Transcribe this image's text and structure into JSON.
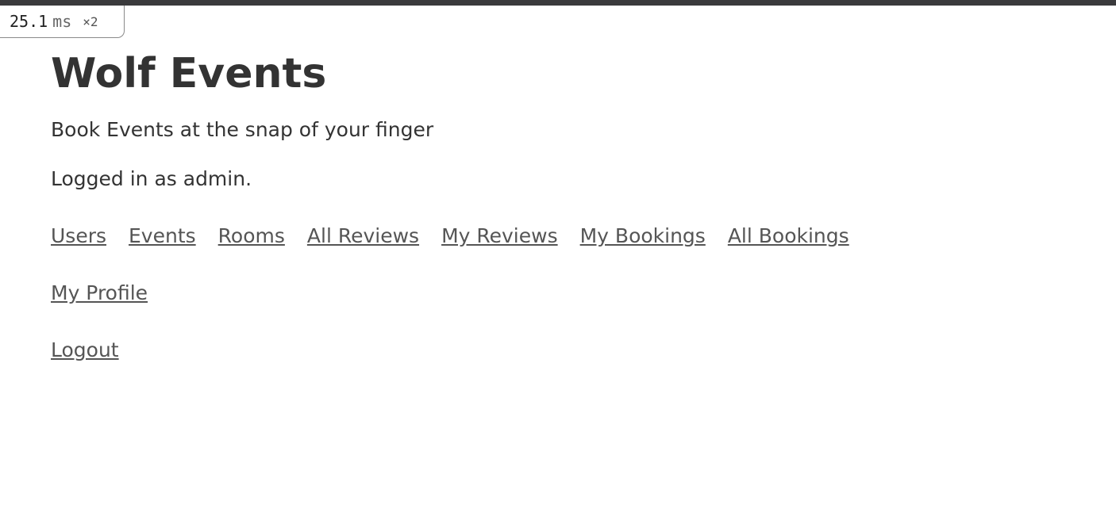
{
  "perf": {
    "value": "25.1",
    "unit": "ms",
    "multiplier": "×2"
  },
  "header": {
    "title": "Wolf Events",
    "tagline": "Book Events at the snap of your finger"
  },
  "status": {
    "login_text": "Logged in as admin."
  },
  "nav": {
    "items": [
      {
        "label": "Users"
      },
      {
        "label": "Events"
      },
      {
        "label": "Rooms"
      },
      {
        "label": "All Reviews"
      },
      {
        "label": "My Reviews"
      },
      {
        "label": "My Bookings"
      },
      {
        "label": "All Bookings"
      }
    ],
    "profile_label": "My Profile",
    "logout_label": "Logout"
  },
  "colors": {
    "text": "#333333",
    "link": "#555555",
    "top_bar": "#3a3a3c"
  }
}
